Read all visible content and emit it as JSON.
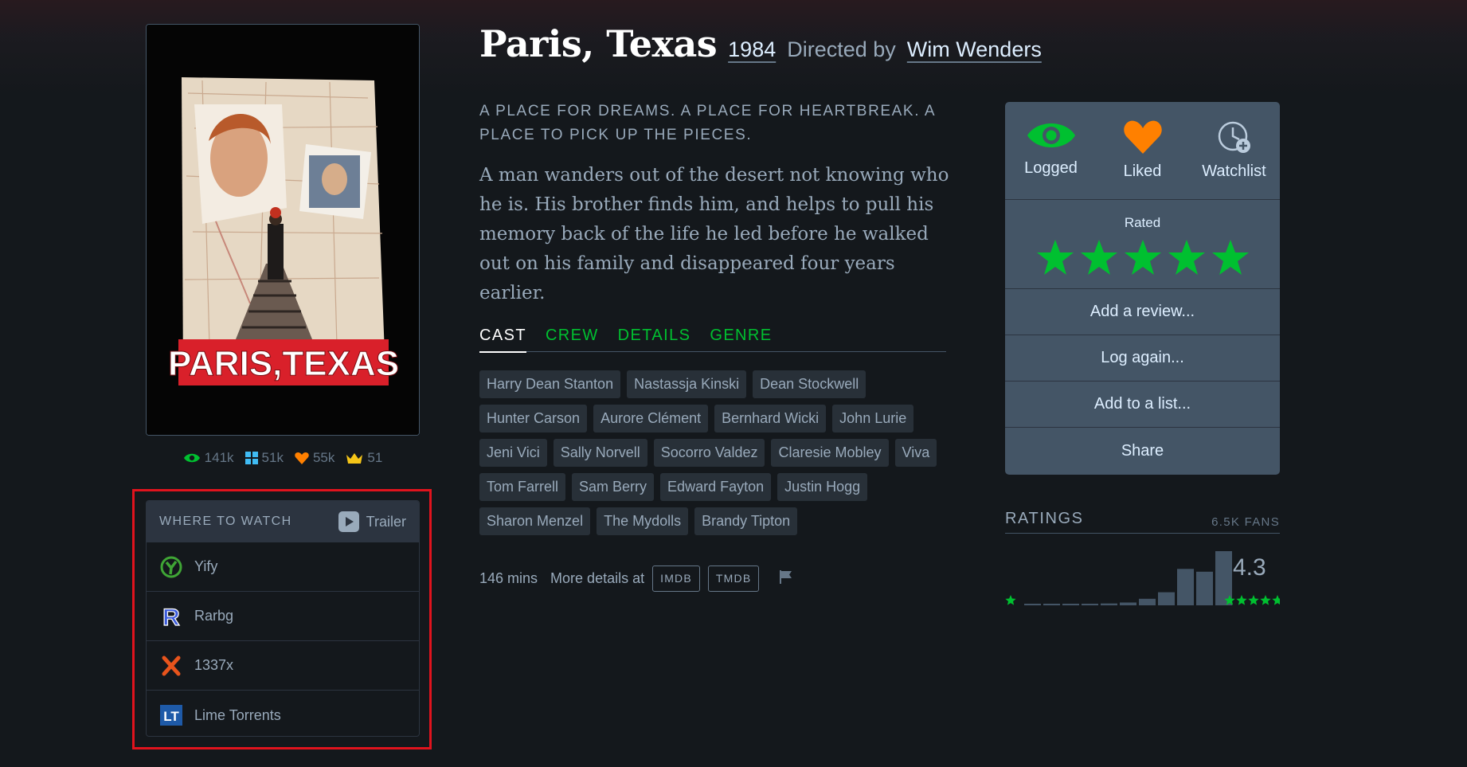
{
  "film": {
    "title": "Paris, Texas",
    "year": "1984",
    "directed_by": "Directed by",
    "director": "Wim Wenders",
    "poster_text": "PARIS,TEXAS",
    "tagline": "A PLACE FOR DREAMS. A PLACE FOR HEARTBREAK. A PLACE TO PICK UP THE PIECES.",
    "synopsis": "A man wanders out of the desert not knowing who he is. His brother finds him, and helps to pull his memory back of the life he led before he walked out on his family and disappeared four years earlier."
  },
  "stats": {
    "watched": "141k",
    "lists": "51k",
    "likes": "55k",
    "top": "51"
  },
  "where_to_watch": {
    "title": "WHERE TO WATCH",
    "trailer": "Trailer",
    "services": [
      {
        "name": "Yify",
        "icon": "yify-icon"
      },
      {
        "name": "Rarbg",
        "icon": "rarbg-icon"
      },
      {
        "name": "1337x",
        "icon": "1337x-icon"
      },
      {
        "name": "Lime Torrents",
        "icon": "limetorrents-icon"
      }
    ]
  },
  "tabs": [
    {
      "label": "CAST",
      "active": true
    },
    {
      "label": "CREW",
      "active": false
    },
    {
      "label": "DETAILS",
      "active": false
    },
    {
      "label": "GENRE",
      "active": false
    }
  ],
  "cast": [
    "Harry Dean Stanton",
    "Nastassja Kinski",
    "Dean Stockwell",
    "Hunter Carson",
    "Aurore Clément",
    "Bernhard Wicki",
    "John Lurie",
    "Jeni Vici",
    "Sally Norvell",
    "Socorro Valdez",
    "Claresie Mobley",
    "Viva",
    "Tom Farrell",
    "Sam Berry",
    "Edward Fayton",
    "Justin Hogg",
    "Sharon Menzel",
    "The Mydolls",
    "Brandy Tipton"
  ],
  "footer": {
    "runtime": "146 mins",
    "more_details": "More details at",
    "imdb": "IMDB",
    "tmdb": "TMDB"
  },
  "actions": {
    "logged": "Logged",
    "liked": "Liked",
    "watchlist": "Watchlist",
    "rated": "Rated",
    "rating_stars": 5,
    "add_review": "Add a review...",
    "log_again": "Log again...",
    "add_to_list": "Add to a list...",
    "share": "Share"
  },
  "ratings": {
    "title": "RATINGS",
    "fans": "6.5K FANS",
    "average": "4.3",
    "histogram": [
      1,
      1,
      1,
      1.5,
      2,
      3,
      7,
      14,
      39,
      36,
      58
    ]
  },
  "colors": {
    "accent_green": "#00c030",
    "accent_orange": "#ff8000",
    "highlight_red": "#e0131d"
  }
}
